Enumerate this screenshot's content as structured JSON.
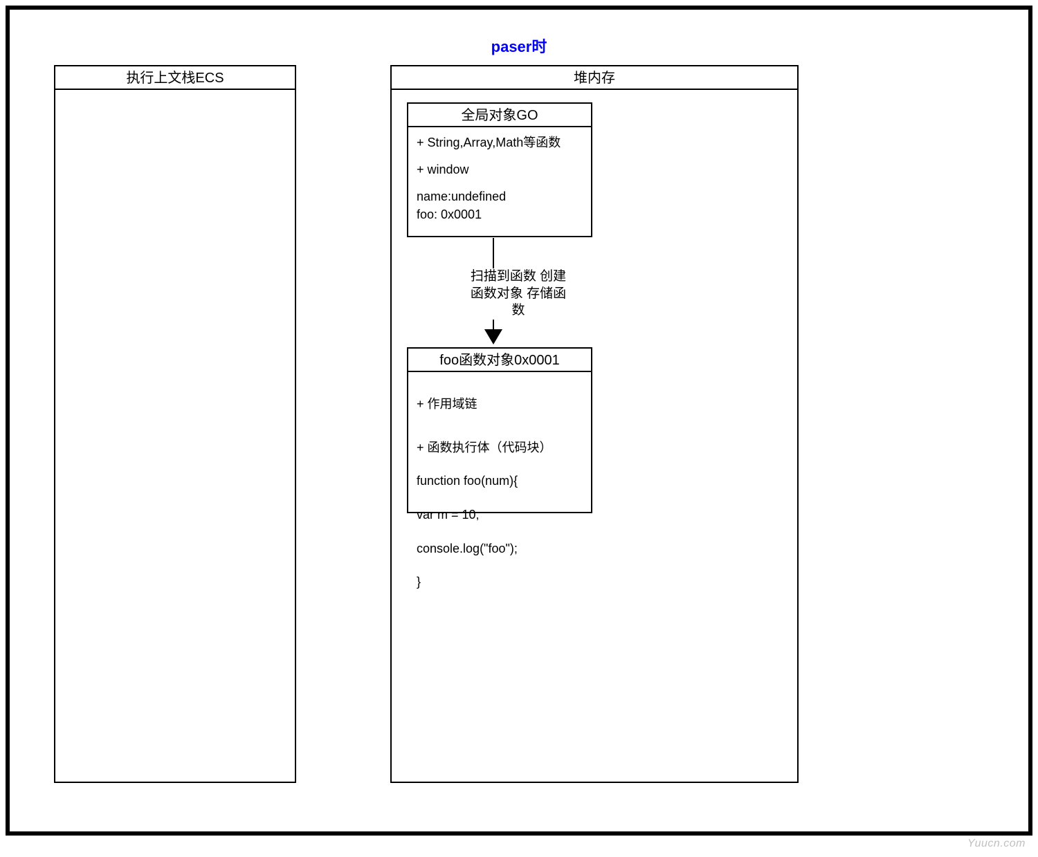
{
  "title": "paser时",
  "ecs": {
    "header": "执行上文栈ECS"
  },
  "heap": {
    "header": "堆内存",
    "go": {
      "header": "全局对象GO",
      "line1": "+ String,Array,Math等函数",
      "line2": "+ window",
      "line3": "name:undefined",
      "line4": "foo: 0x0001"
    },
    "arrow_text": "扫描到函数\n创建函数对象\n存储函数",
    "foo": {
      "header": "foo函数对象0x0001",
      "line1": "+ 作用域链",
      "line2": "+ 函数执行体（代码块）",
      "line3": "function foo(num){",
      "line4": "  var m = 10;",
      "line5": " console.log(\"foo\");",
      "line6": "}"
    }
  },
  "watermark": "Yuucn.com"
}
